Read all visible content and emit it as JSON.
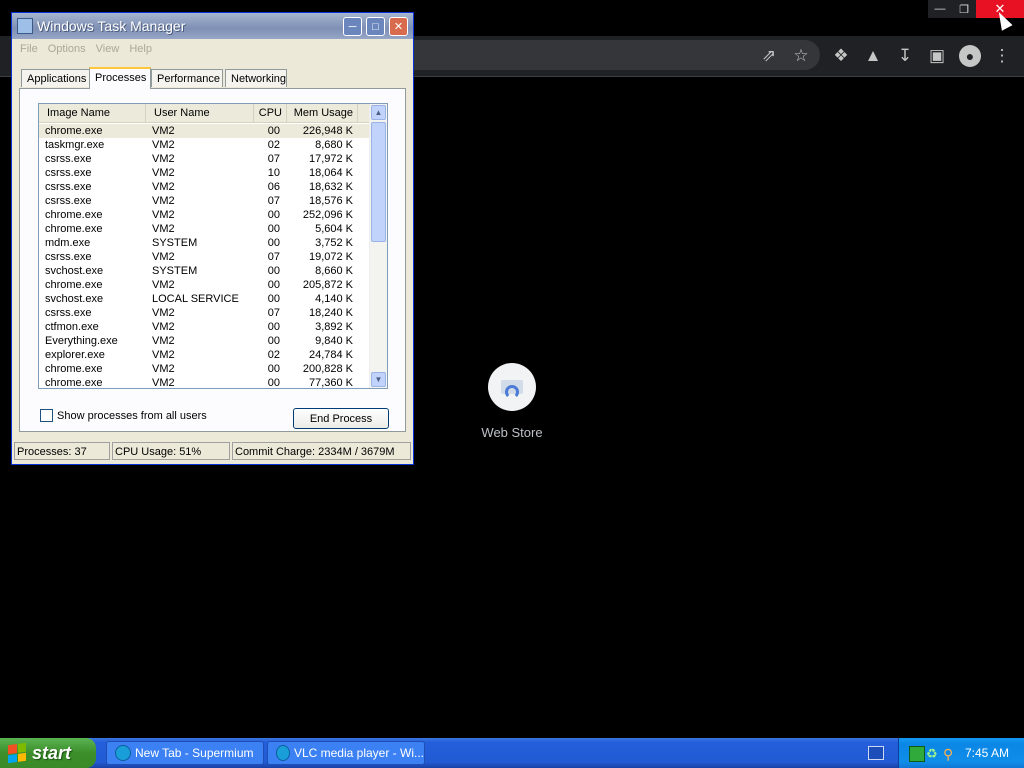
{
  "browser": {
    "ntp_tile_label": "Web Store"
  },
  "taskmgr": {
    "title": "Windows Task Manager",
    "menu": [
      "File",
      "Options",
      "View",
      "Help"
    ],
    "tabs": [
      "Applications",
      "Processes",
      "Performance",
      "Networking"
    ],
    "active_tab": "Processes",
    "columns": [
      "Image Name",
      "User Name",
      "CPU",
      "Mem Usage"
    ],
    "rows": [
      {
        "name": "chrome.exe",
        "user": "VM2",
        "cpu": "00",
        "mem": "226,948 K"
      },
      {
        "name": "taskmgr.exe",
        "user": "VM2",
        "cpu": "02",
        "mem": "8,680 K"
      },
      {
        "name": "csrss.exe",
        "user": "VM2",
        "cpu": "07",
        "mem": "17,972 K"
      },
      {
        "name": "csrss.exe",
        "user": "VM2",
        "cpu": "10",
        "mem": "18,064 K"
      },
      {
        "name": "csrss.exe",
        "user": "VM2",
        "cpu": "06",
        "mem": "18,632 K"
      },
      {
        "name": "csrss.exe",
        "user": "VM2",
        "cpu": "07",
        "mem": "18,576 K"
      },
      {
        "name": "chrome.exe",
        "user": "VM2",
        "cpu": "00",
        "mem": "252,096 K"
      },
      {
        "name": "chrome.exe",
        "user": "VM2",
        "cpu": "00",
        "mem": "5,604 K"
      },
      {
        "name": "mdm.exe",
        "user": "SYSTEM",
        "cpu": "00",
        "mem": "3,752 K"
      },
      {
        "name": "csrss.exe",
        "user": "VM2",
        "cpu": "07",
        "mem": "19,072 K"
      },
      {
        "name": "svchost.exe",
        "user": "SYSTEM",
        "cpu": "00",
        "mem": "8,660 K"
      },
      {
        "name": "chrome.exe",
        "user": "VM2",
        "cpu": "00",
        "mem": "205,872 K"
      },
      {
        "name": "svchost.exe",
        "user": "LOCAL SERVICE",
        "cpu": "00",
        "mem": "4,140 K"
      },
      {
        "name": "csrss.exe",
        "user": "VM2",
        "cpu": "07",
        "mem": "18,240 K"
      },
      {
        "name": "ctfmon.exe",
        "user": "VM2",
        "cpu": "00",
        "mem": "3,892 K"
      },
      {
        "name": "Everything.exe",
        "user": "VM2",
        "cpu": "00",
        "mem": "9,840 K"
      },
      {
        "name": "explorer.exe",
        "user": "VM2",
        "cpu": "02",
        "mem": "24,784 K"
      },
      {
        "name": "chrome.exe",
        "user": "VM2",
        "cpu": "00",
        "mem": "200,828 K"
      },
      {
        "name": "chrome.exe",
        "user": "VM2",
        "cpu": "00",
        "mem": "77,360 K"
      }
    ],
    "show_all_label": "Show processes from all users",
    "end_process_label": "End Process",
    "status": {
      "processes": "Processes: 37",
      "cpu": "CPU Usage: 51%",
      "commit": "Commit Charge: 2334M / 3679M"
    }
  },
  "taskbar": {
    "start_label": "start",
    "tasks": [
      "New Tab - Supermium",
      "VLC media player - Wi..."
    ],
    "clock": "7:45 AM"
  },
  "colors": {
    "xp_blue": "#245edb",
    "start_green": "#3c8e2a",
    "close_red": "#e81123",
    "chrome_toolbar": "#202124"
  },
  "icons": {
    "toolbar": [
      "share-icon",
      "bookmark-star-icon",
      "extensions-icon",
      "flask-icon",
      "download-icon",
      "sidepanel-icon",
      "profile-icon",
      "menu-kebab-icon"
    ]
  }
}
